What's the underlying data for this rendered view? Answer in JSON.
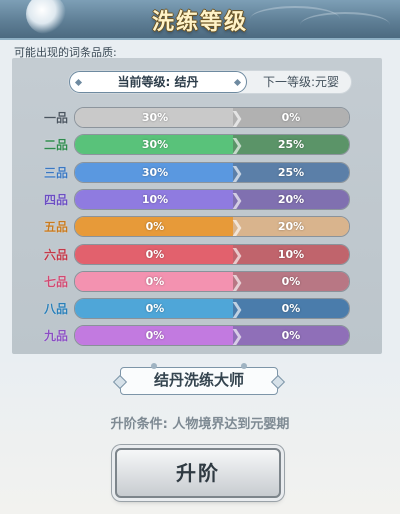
{
  "title": "洗练等级",
  "subtitle": "可能出现的词条品质:",
  "tabs": {
    "current": "当前等级: 结丹",
    "next": "下一等级:元婴"
  },
  "rows": [
    {
      "grade": "一品",
      "grade_color": "#4a5560",
      "current": "30%",
      "next": "0%",
      "left_color": "#c9c9c9",
      "right_color": "#b1b1b1"
    },
    {
      "grade": "二品",
      "grade_color": "#2f8a4e",
      "current": "30%",
      "next": "25%",
      "left_color": "#59c27a",
      "right_color": "#5b9468"
    },
    {
      "grade": "三品",
      "grade_color": "#3a78c2",
      "current": "30%",
      "next": "25%",
      "left_color": "#5a98e0",
      "right_color": "#5b7fa8"
    },
    {
      "grade": "四品",
      "grade_color": "#6b4fc2",
      "current": "10%",
      "next": "20%",
      "left_color": "#8f7be0",
      "right_color": "#8070b0"
    },
    {
      "grade": "五品",
      "grade_color": "#c77a1f",
      "current": "0%",
      "next": "20%",
      "left_color": "#e79a39",
      "right_color": "#d9b48d"
    },
    {
      "grade": "六品",
      "grade_color": "#c23a4a",
      "current": "0%",
      "next": "10%",
      "left_color": "#e2616d",
      "right_color": "#c0646c"
    },
    {
      "grade": "七品",
      "grade_color": "#d04a72",
      "current": "0%",
      "next": "0%",
      "left_color": "#f392b0",
      "right_color": "#b87784"
    },
    {
      "grade": "八品",
      "grade_color": "#2a7fb8",
      "current": "0%",
      "next": "0%",
      "left_color": "#4fa6d8",
      "right_color": "#4a7cab"
    },
    {
      "grade": "九品",
      "grade_color": "#8a4fc2",
      "current": "0%",
      "next": "0%",
      "left_color": "#c27ae0",
      "right_color": "#8f6fb8"
    }
  ],
  "master_title": "结丹洗练大师",
  "condition": "升阶条件: 人物境界达到元婴期",
  "upgrade_button": "升阶"
}
